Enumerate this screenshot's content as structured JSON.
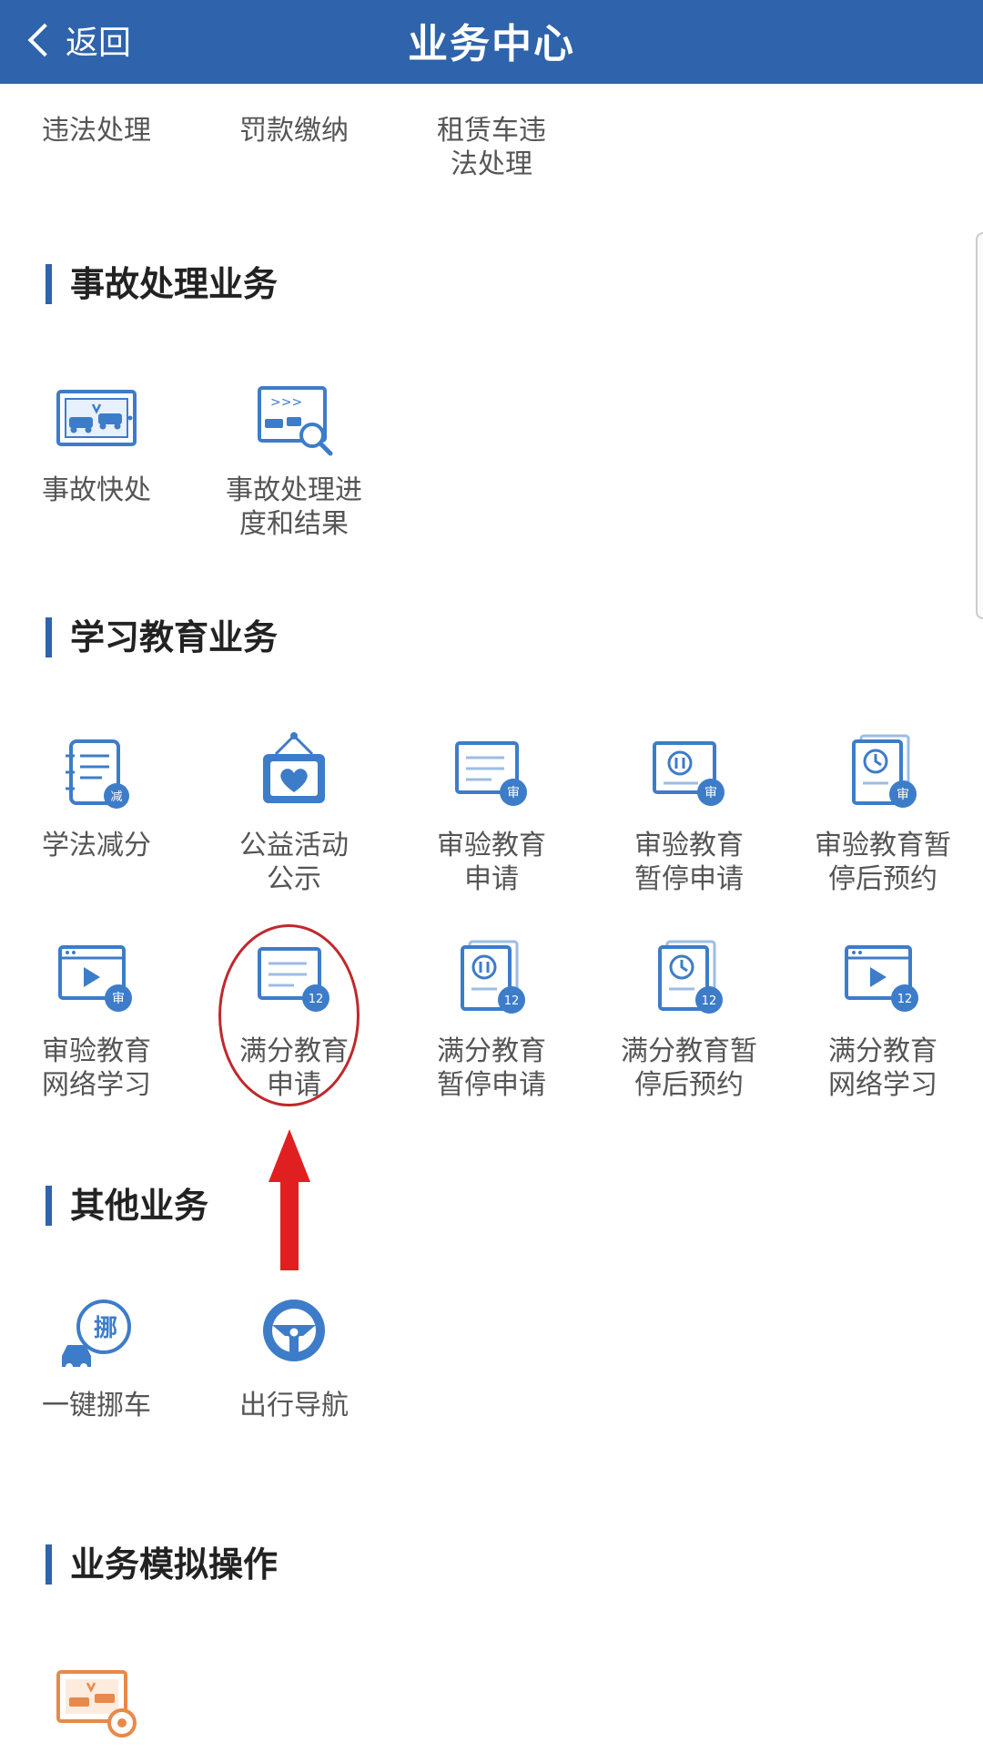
{
  "header": {
    "back_label": "返回",
    "title": "业务中心"
  },
  "top_row": [
    {
      "label": "违法处理"
    },
    {
      "label": "罚款缴纳"
    },
    {
      "label": "租赁车违\n法处理"
    }
  ],
  "sections": {
    "accident": {
      "title": "事故处理业务",
      "items": [
        {
          "label": "事故快处"
        },
        {
          "label": "事故处理进\n度和结果",
          "icon_text": ">>>"
        }
      ]
    },
    "education": {
      "title": "学习教育业务",
      "items": [
        {
          "label": "学法减分",
          "badge": "减"
        },
        {
          "label": "公益活动\n公示"
        },
        {
          "label": "审验教育\n申请",
          "badge": "审"
        },
        {
          "label": "审验教育\n暂停申请",
          "badge": "审"
        },
        {
          "label": "审验教育暂\n停后预约",
          "badge": "审"
        },
        {
          "label": "审验教育\n网络学习",
          "badge": "审"
        },
        {
          "label": "满分教育\n申请",
          "badge": "12"
        },
        {
          "label": "满分教育\n暂停申请",
          "badge": "12"
        },
        {
          "label": "满分教育暂\n停后预约",
          "badge": "12"
        },
        {
          "label": "满分教育\n网络学习",
          "badge": "12"
        }
      ]
    },
    "other": {
      "title": "其他业务",
      "items": [
        {
          "label": "一键挪车",
          "badge": "挪"
        },
        {
          "label": "出行导航"
        }
      ]
    },
    "simulation": {
      "title": "业务模拟操作"
    }
  },
  "colors": {
    "brand": "#2f63ab",
    "icon_blue": "#3d7cc9",
    "orange": "#e8894a",
    "annotation": "#c0282b",
    "arrow": "#e02020"
  }
}
